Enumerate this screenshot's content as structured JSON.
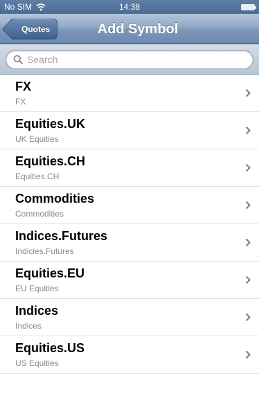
{
  "status_bar": {
    "carrier": "No SIM",
    "time": "14:38"
  },
  "nav": {
    "back_label": "Quotes",
    "title": "Add Symbol"
  },
  "search": {
    "placeholder": "Search",
    "value": ""
  },
  "items": [
    {
      "title": "FX",
      "subtitle": "FX"
    },
    {
      "title": "Equities.UK",
      "subtitle": "UK Equities"
    },
    {
      "title": "Equities.CH",
      "subtitle": "Equities.CH"
    },
    {
      "title": "Commodities",
      "subtitle": "Commodities"
    },
    {
      "title": "Indices.Futures",
      "subtitle": "Indicies.Futures"
    },
    {
      "title": "Equities.EU",
      "subtitle": "EU Equities"
    },
    {
      "title": "Indices",
      "subtitle": "Indices"
    },
    {
      "title": "Equities.US",
      "subtitle": "US Equities"
    }
  ],
  "icons": {
    "status_wifi": "wifi-icon",
    "status_battery": "battery-icon",
    "search": "search-icon",
    "row_disclosure": "chevron-right-icon"
  },
  "colors": {
    "nav_bar": "#7d97b9",
    "status_bar": "#4a6b93",
    "title_text": "#000000",
    "subtitle_text": "#8a8a8a"
  }
}
